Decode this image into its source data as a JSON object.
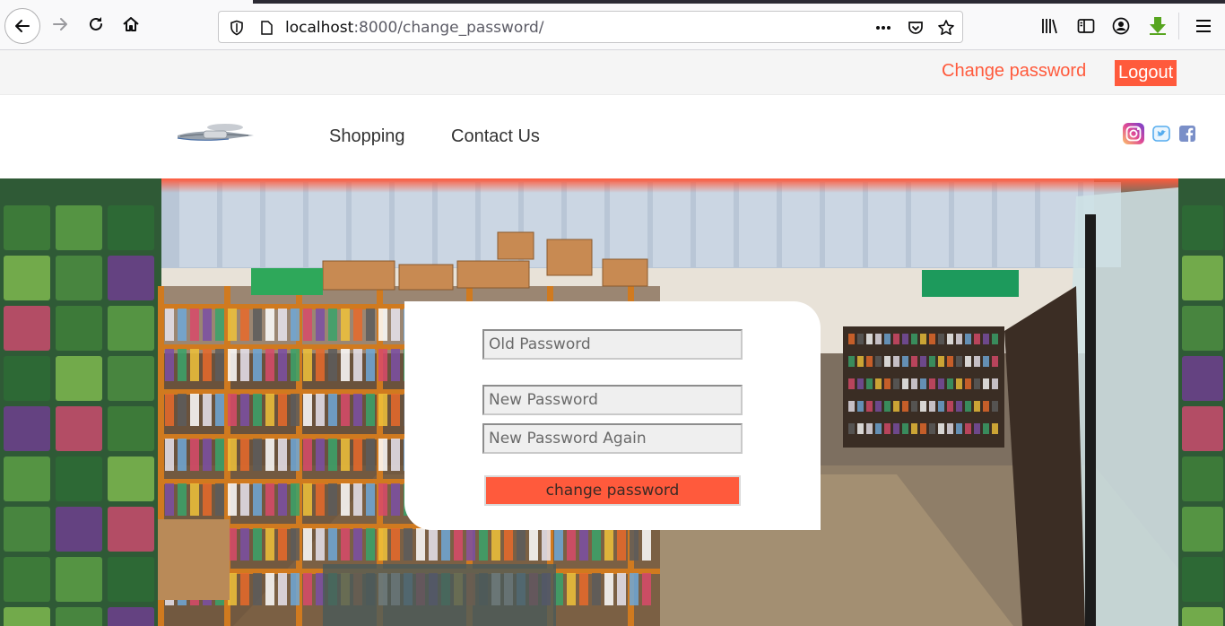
{
  "browser": {
    "url_host": "localhost",
    "url_path": ":8000/change_password/",
    "icons": [
      "back-icon",
      "forward-icon",
      "reload-icon",
      "home-icon",
      "shield-icon",
      "page-icon",
      "more-icon",
      "pocket-icon",
      "star-icon",
      "library-icon",
      "sidebar-icon",
      "account-icon",
      "download-icon",
      "hamburger-icon"
    ]
  },
  "utility_bar": {
    "change_password_label": "Change password",
    "logout_label": "Logout"
  },
  "header": {
    "nav": [
      {
        "label": "Shopping"
      },
      {
        "label": "Contact Us"
      }
    ],
    "social_icons": [
      "instagram-icon",
      "twitter-icon",
      "facebook-icon"
    ]
  },
  "form": {
    "old_password_placeholder": "Old Password",
    "new_password_placeholder": "New Password",
    "new_password_again_placeholder": "New Password Again",
    "submit_label": "change password"
  },
  "colors": {
    "accent": "#ff5a3c",
    "card_bg": "#ffffff",
    "util_bar_bg": "#f5f5f5"
  }
}
